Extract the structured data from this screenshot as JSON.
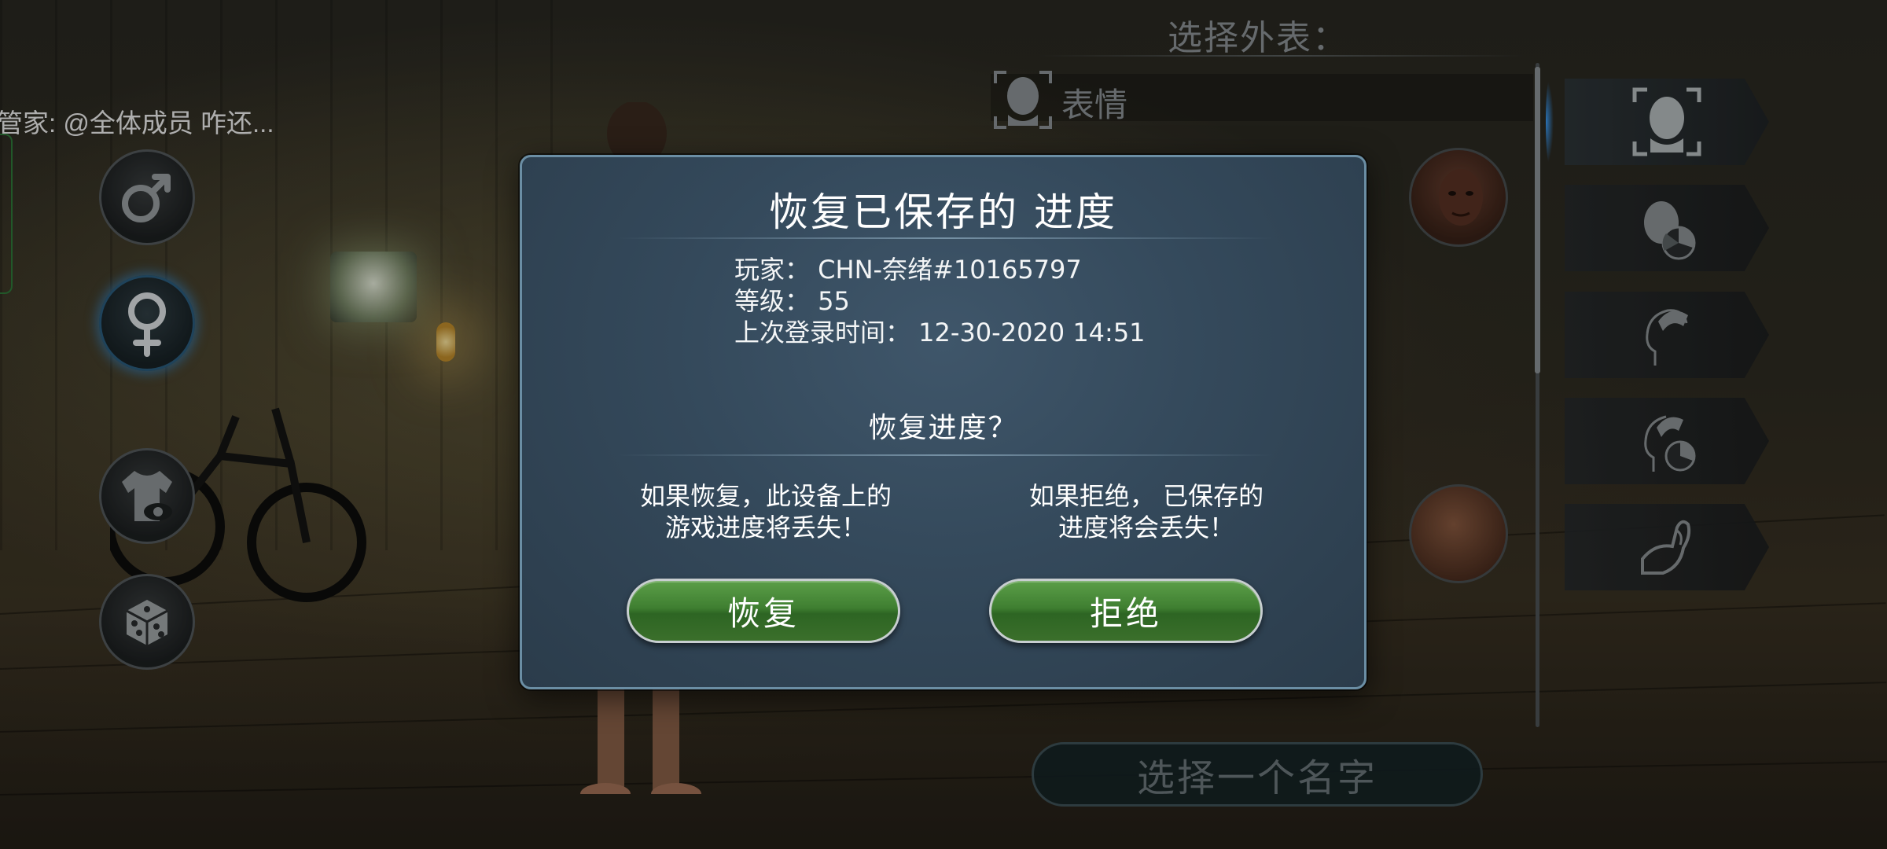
{
  "chat": {
    "text": "管家: @全体成员 咋还..."
  },
  "appearance": {
    "title": "选择外表：",
    "section_label": "表情",
    "name_placeholder": "选择一个名字"
  },
  "side_buttons": [
    {
      "icon": "male-icon"
    },
    {
      "icon": "female-icon",
      "active": true
    },
    {
      "icon": "clothing-icon"
    },
    {
      "icon": "dice-icon"
    }
  ],
  "category_tabs": [
    {
      "icon": "face-icon",
      "active": true
    },
    {
      "icon": "skin-tone-icon"
    },
    {
      "icon": "hair-icon"
    },
    {
      "icon": "hair-color-icon"
    },
    {
      "icon": "body-icon"
    }
  ],
  "dialog": {
    "title": "恢复已保存的 进度",
    "player_line": "玩家： CHN-奈绪#10165797",
    "level_line": "等级： 55",
    "last_login_line": "上次登录时间： 12-30-2020 14:51",
    "question": "恢复进度？",
    "restore_note_line1": "如果恢复，此设备上的",
    "restore_note_line2": "游戏进度将丢失！",
    "reject_note_line1": "如果拒绝， 已保存的",
    "reject_note_line2": "进度将会丢失！",
    "restore_button": "恢复",
    "reject_button": "拒绝"
  },
  "colors": {
    "button_green": "#3f7f31",
    "dialog_bg": "#34495b",
    "dialog_border": "#6b8ea4",
    "active_glow": "#3aa0ff"
  }
}
